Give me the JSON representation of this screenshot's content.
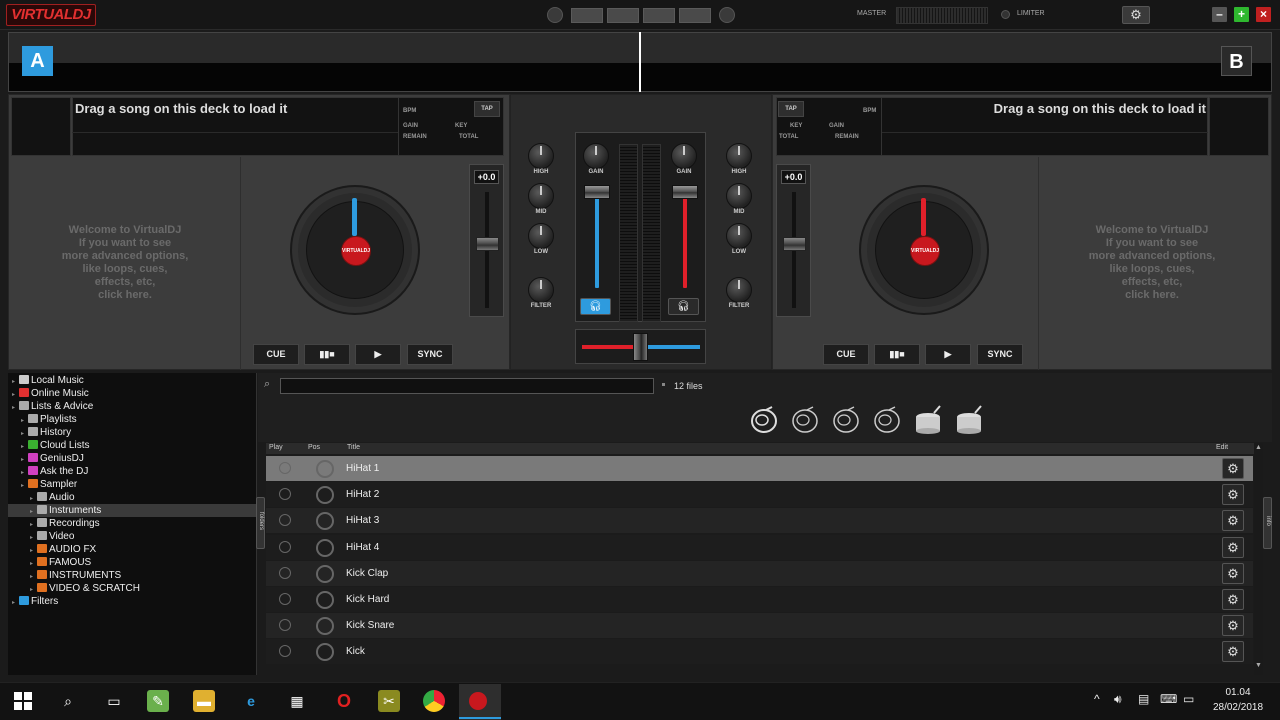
{
  "app": {
    "logo": "VIRTUALDJ"
  },
  "topbar": {
    "master_label": "MASTER",
    "limiter_label": "LIMITER",
    "settings_icon": "gear-icon",
    "window_buttons": [
      "–",
      "+",
      "×"
    ]
  },
  "waveform": {
    "deck_a_letter": "A",
    "deck_b_letter": "B"
  },
  "deck_a": {
    "title": "Drag a song on this deck to load it",
    "labels": {
      "bpm": "BPM",
      "tap": "TAP",
      "gain": "GAIN",
      "key": "KEY",
      "remain": "REMAIN",
      "total": "TOTAL"
    },
    "welcome": [
      "Welcome to VirtualDJ",
      "If you want to see",
      "more advanced options,",
      "like loops, cues,",
      "effects, etc,",
      "click here."
    ],
    "jog_label": "VIRTUALDJ",
    "pitch": "+0.0",
    "buttons": [
      "CUE",
      "▮▮■",
      "▶",
      "SYNC"
    ],
    "accent": "#2e9bde"
  },
  "deck_b": {
    "title": "Drag a song on this deck to load it",
    "labels": {
      "bpm": "BPM",
      "tap": "TAP",
      "gain": "GAIN",
      "key": "KEY",
      "remain": "REMAIN",
      "total": "TOTAL"
    },
    "welcome": [
      "Welcome to VirtualDJ",
      "If you want to see",
      "more advanced options,",
      "like loops, cues,",
      "effects, etc,",
      "click here."
    ],
    "jog_label": "VIRTUALDJ",
    "pitch": "+0.0",
    "buttons": [
      "CUE",
      "▮▮■",
      "▶",
      "SYNC"
    ],
    "accent": "#e0202a"
  },
  "mixer": {
    "eq_labels": [
      "HIGH",
      "MID",
      "LOW",
      "FILTER"
    ],
    "gain_label": "GAIN",
    "headphone_icon": "headphones-icon",
    "colors": {
      "left": "#2e9bde",
      "right": "#e0202a"
    }
  },
  "browser": {
    "tree": [
      {
        "label": "Local Music",
        "level": 0,
        "icon": "#cccccc"
      },
      {
        "label": "Online Music",
        "level": 0,
        "icon": "#e03030"
      },
      {
        "label": "Lists & Advice",
        "level": 0,
        "icon": "#aaaaaa"
      },
      {
        "label": "Playlists",
        "level": 1,
        "icon": "#aaaaaa"
      },
      {
        "label": "History",
        "level": 1,
        "icon": "#aaaaaa"
      },
      {
        "label": "Cloud Lists",
        "level": 1,
        "icon": "#3ab030"
      },
      {
        "label": "GeniusDJ",
        "level": 1,
        "icon": "#d040c0"
      },
      {
        "label": "Ask the DJ",
        "level": 1,
        "icon": "#d040c0"
      },
      {
        "label": "Sampler",
        "level": 1,
        "icon": "#e07020"
      },
      {
        "label": "Audio",
        "level": 2,
        "icon": "#aaaaaa"
      },
      {
        "label": "Instruments",
        "level": 2,
        "icon": "#aaaaaa",
        "selected": true
      },
      {
        "label": "Recordings",
        "level": 2,
        "icon": "#aaaaaa"
      },
      {
        "label": "Video",
        "level": 2,
        "icon": "#aaaaaa"
      },
      {
        "label": "AUDIO FX",
        "level": 2,
        "icon": "#e07020"
      },
      {
        "label": "FAMOUS",
        "level": 2,
        "icon": "#e07020"
      },
      {
        "label": "INSTRUMENTS",
        "level": 2,
        "icon": "#e07020"
      },
      {
        "label": "VIDEO & SCRATCH",
        "level": 2,
        "icon": "#e07020"
      },
      {
        "label": "Filters",
        "level": 0,
        "icon": "#2e9bde"
      }
    ],
    "folders_tab": "folders",
    "info_tab": "info",
    "search": {
      "placeholder": "",
      "value": ""
    },
    "file_count": "12 files",
    "columns": [
      "Play",
      "Pos",
      "Title",
      "Edit"
    ],
    "rows": [
      {
        "title": "HiHat 1",
        "kind": "cymbal",
        "selected": true
      },
      {
        "title": "HiHat 2",
        "kind": "cymbal"
      },
      {
        "title": "HiHat 3",
        "kind": "cymbal"
      },
      {
        "title": "HiHat 4",
        "kind": "cymbal"
      },
      {
        "title": "Kick Clap",
        "kind": "drum"
      },
      {
        "title": "Kick Hard",
        "kind": "drum"
      },
      {
        "title": "Kick Snare",
        "kind": "drum"
      },
      {
        "title": "Kick",
        "kind": "drum"
      }
    ]
  },
  "taskbar": {
    "time": "01.04",
    "date": "28/02/2018"
  }
}
